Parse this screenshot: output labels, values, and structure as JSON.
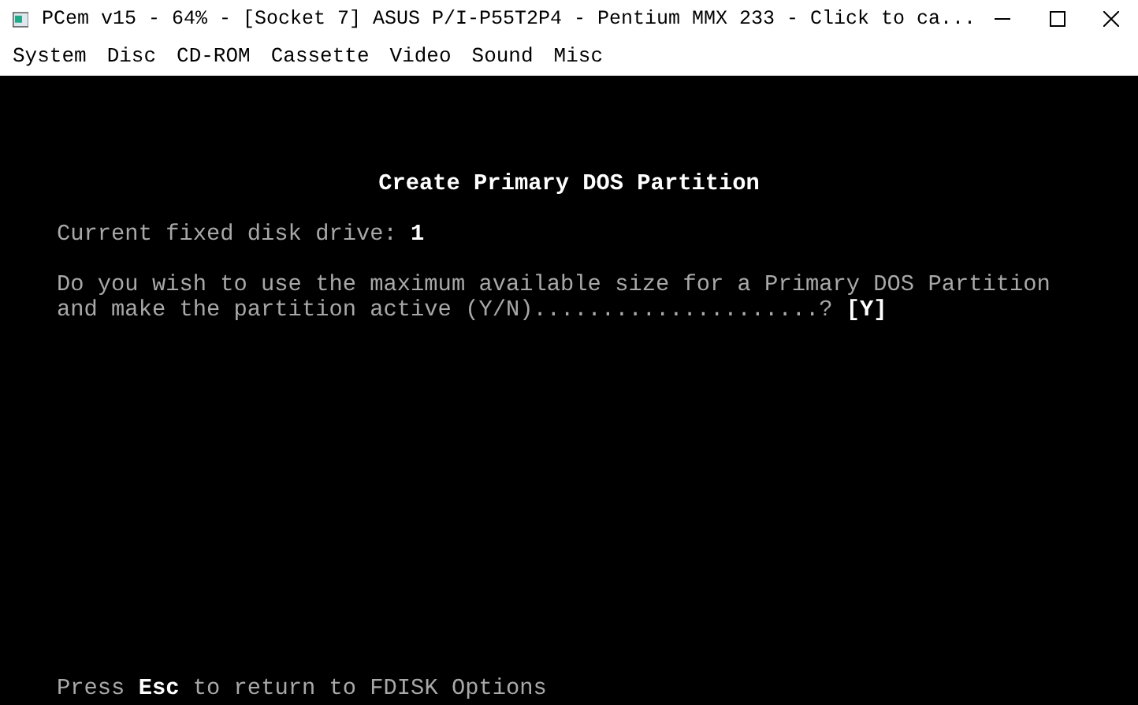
{
  "window": {
    "title": "PCem v15 - 64% - [Socket 7] ASUS P/I-P55T2P4 - Pentium MMX 233 - Click to ca..."
  },
  "menu": [
    "System",
    "Disc",
    "CD-ROM",
    "Cassette",
    "Video",
    "Sound",
    "Misc"
  ],
  "screen": {
    "heading": "Create Primary DOS Partition",
    "lines": [
      "Current fixed disk drive: **1**",
      "Do you wish to use the maximum available size for a Primary DOS Partition",
      "and make the partition active (Y/N).....................? **[Y]**"
    ],
    "footer": "Press **Esc** to return to FDISK Options"
  }
}
